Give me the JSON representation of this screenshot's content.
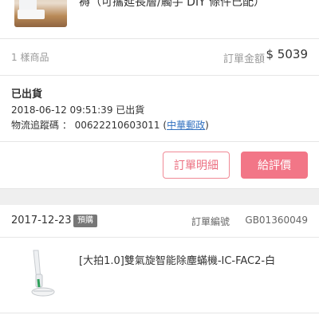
{
  "top_item": {
    "title_partial": "褥（可攜延長層/觸手 DIY 條件已配）"
  },
  "summary": {
    "quantity": "1 樣商品",
    "amount_label": "訂單金額",
    "amount": "$ 5039"
  },
  "shipping": {
    "status": "已出貨",
    "shipped_time": "2018-06-12 09:51:39 已出貨",
    "tracking_label": "物流追蹤碼 ：",
    "tracking_number": "00622210603011",
    "carrier_open": "(",
    "carrier": "中華郵政",
    "carrier_close": ")"
  },
  "actions": {
    "detail_label": "訂單明細",
    "review_label": "給評價"
  },
  "order": {
    "date": "2017-12-23",
    "badge": "預購",
    "order_no_label": "訂單編號",
    "order_no": "GB01360049"
  },
  "item2": {
    "title": "[大拍1.0]雙氣旋智能除塵蟎機-IC-FAC2-白"
  },
  "colors": {
    "accent": "#f27687",
    "link": "#2f6fbf"
  }
}
